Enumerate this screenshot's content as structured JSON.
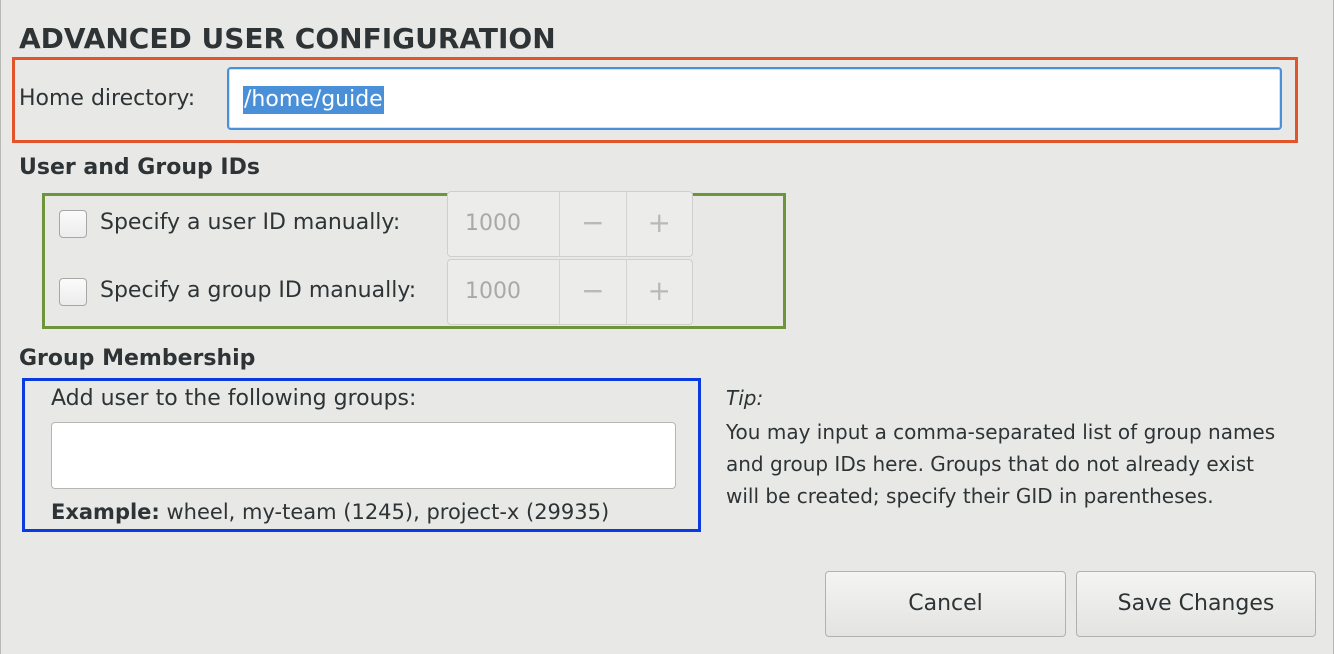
{
  "dialog": {
    "title": "ADVANCED USER CONFIGURATION"
  },
  "home": {
    "label": "Home directory:",
    "value": "/home/guide"
  },
  "ids": {
    "heading": "User and Group IDs",
    "user": {
      "label": "Specify a user ID manually:",
      "checked": false,
      "value": "1000",
      "minus": "−",
      "plus": "+"
    },
    "group": {
      "label": "Specify a group ID manually:",
      "checked": false,
      "value": "1000",
      "minus": "−",
      "plus": "+"
    }
  },
  "membership": {
    "heading": "Group Membership",
    "label": "Add user to the following groups:",
    "value": "",
    "example_bold": "Example:",
    "example_text": " wheel, my-team (1245), project-x (29935)"
  },
  "tip": {
    "title": "Tip:",
    "body": "You may input a comma-separated list of group names and group IDs here. Groups that do not already exist will be created; specify their GID in parentheses."
  },
  "buttons": {
    "cancel": "Cancel",
    "save": "Save Changes"
  },
  "colors": {
    "highlight_red": "#e2542b",
    "highlight_green": "#6d963a",
    "highlight_blue": "#0a3be0",
    "selection": "#4a90d9"
  }
}
